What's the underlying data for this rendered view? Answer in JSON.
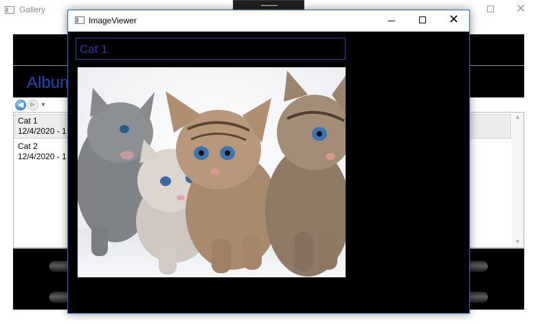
{
  "gallery": {
    "title": "Gallery",
    "album_title": "Albums",
    "items": [
      {
        "name": "Cat 1",
        "date": "12/4/2020 - 1"
      },
      {
        "name": "Cat 2",
        "date": "12/4/2020 - 1"
      }
    ]
  },
  "viewer": {
    "title": "ImageViewer",
    "name_value": "Cat 1",
    "image_subject": "four kittens"
  },
  "colors": {
    "accent_blue": "#2346b9",
    "window_border": "#1a6fd1",
    "band_black": "#000000"
  },
  "icons": {
    "back": "back-arrow-icon",
    "forward": "forward-arrow-icon",
    "close": "close-icon",
    "maximize": "maximize-icon",
    "minimize": "minimize-icon"
  }
}
